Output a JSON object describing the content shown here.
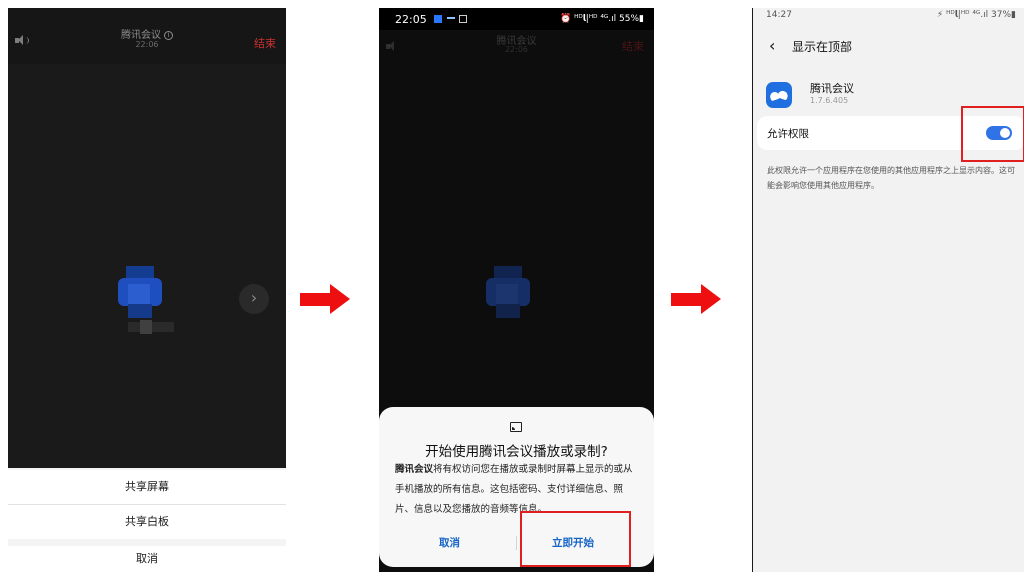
{
  "meeting": {
    "title": "腾讯会议",
    "time": "22:06",
    "end_label": "结束"
  },
  "share_sheet": {
    "share_screen": "共享屏幕",
    "share_whiteboard": "共享白板",
    "cancel": "取消"
  },
  "status_bar_2": {
    "time": "22:05",
    "right": "⏰ ᴴᴰ𝗹|ᴴᴰ ⁴ᴳ.ıl 55%▮"
  },
  "cast_dialog": {
    "title": "开始使用腾讯会议播放或录制?",
    "app_name": "腾讯会议",
    "body": "将有权访问您在播放或录制时屏幕上显示的或从手机播放的所有信息。这包括密码、支付详细信息、照片、信息以及您播放的音频等信息。",
    "cancel": "取消",
    "start": "立即开始"
  },
  "settings": {
    "status_time": "14:27",
    "status_right": "⚡ ᴴᴰ𝗹|ᴴᴰ ⁴ᴳ.ıl 37%▮",
    "page_title": "显示在顶部",
    "app_name": "腾讯会议",
    "app_version": "1.7.6.405",
    "permission_label": "允许权限",
    "permission_enabled": true,
    "description": "此权限允许一个应用程序在您使用的其他应用程序之上显示内容。这可能会影响您使用其他应用程序。"
  },
  "colors": {
    "arrow": "#ee1010",
    "highlight_box": "#e02020",
    "accent_blue": "#1664c8",
    "end_red": "#c93030"
  },
  "icons": [
    "speaker-icon",
    "info-icon",
    "chevron-right-icon",
    "cast-icon",
    "back-arrow-icon",
    "tencent-meeting-app-icon"
  ]
}
